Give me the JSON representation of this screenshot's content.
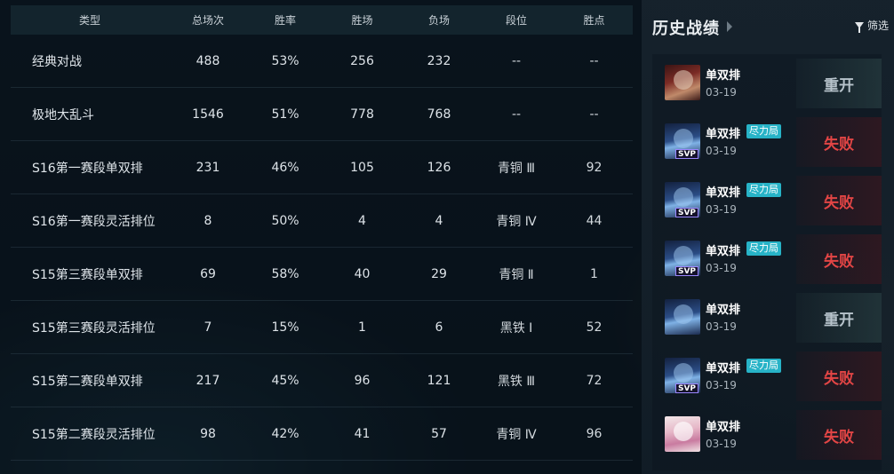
{
  "table": {
    "headers": {
      "type": "类型",
      "total": "总场次",
      "rate": "胜率",
      "wins": "胜场",
      "losses": "负场",
      "tier": "段位",
      "lp": "胜点"
    },
    "rows": [
      {
        "type": "经典对战",
        "total": "488",
        "rate": "53%",
        "wins": "256",
        "losses": "232",
        "tier": "--",
        "lp": "--"
      },
      {
        "type": "极地大乱斗",
        "total": "1546",
        "rate": "51%",
        "wins": "778",
        "losses": "768",
        "tier": "--",
        "lp": "--"
      },
      {
        "type": "S16第一赛段单双排",
        "total": "231",
        "rate": "46%",
        "wins": "105",
        "losses": "126",
        "tier": "青铜 Ⅲ",
        "lp": "92"
      },
      {
        "type": "S16第一赛段灵活排位",
        "total": "8",
        "rate": "50%",
        "wins": "4",
        "losses": "4",
        "tier": "青铜 Ⅳ",
        "lp": "44"
      },
      {
        "type": "S15第三赛段单双排",
        "total": "69",
        "rate": "58%",
        "wins": "40",
        "losses": "29",
        "tier": "青铜 Ⅱ",
        "lp": "1"
      },
      {
        "type": "S15第三赛段灵活排位",
        "total": "7",
        "rate": "15%",
        "wins": "1",
        "losses": "6",
        "tier": "黑铁 Ⅰ",
        "lp": "52"
      },
      {
        "type": "S15第二赛段单双排",
        "total": "217",
        "rate": "45%",
        "wins": "96",
        "losses": "121",
        "tier": "黑铁 Ⅲ",
        "lp": "72"
      },
      {
        "type": "S15第二赛段灵活排位",
        "total": "98",
        "rate": "42%",
        "wins": "41",
        "losses": "57",
        "tier": "青铜 Ⅳ",
        "lp": "96"
      }
    ]
  },
  "history": {
    "title": "历史战绩",
    "filter_label": "筛选",
    "matches": [
      {
        "mode": "单双排",
        "date": "03-19",
        "result": "重开",
        "badge": "",
        "svp": "",
        "avatar": "red-champion-avatar"
      },
      {
        "mode": "单双排",
        "date": "03-19",
        "result": "失败",
        "badge": "尽力局",
        "svp": "SVP",
        "avatar": "blue-champion-avatar"
      },
      {
        "mode": "单双排",
        "date": "03-19",
        "result": "失败",
        "badge": "尽力局",
        "svp": "SVP",
        "avatar": "blue-champion-avatar"
      },
      {
        "mode": "单双排",
        "date": "03-19",
        "result": "失败",
        "badge": "尽力局",
        "svp": "SVP",
        "avatar": "blue-champion-avatar"
      },
      {
        "mode": "单双排",
        "date": "03-19",
        "result": "重开",
        "badge": "",
        "svp": "",
        "avatar": "blue-champion-avatar"
      },
      {
        "mode": "单双排",
        "date": "03-19",
        "result": "失败",
        "badge": "尽力局",
        "svp": "SVP",
        "avatar": "blue-champion-avatar"
      },
      {
        "mode": "单双排",
        "date": "03-19",
        "result": "失败",
        "badge": "",
        "svp": "",
        "avatar": "pink-champion-avatar"
      }
    ]
  },
  "colors": {
    "lose": "#e24545",
    "remake": "#b7c3cb",
    "badge": "#27b3c7",
    "header_bg": "#13242d"
  }
}
